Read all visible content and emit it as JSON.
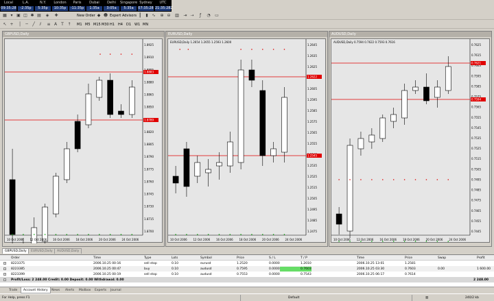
{
  "clocks": [
    {
      "city": "Local",
      "time": "09:35:28"
    },
    {
      "city": "L.A.",
      "time": "-2:35p"
    },
    {
      "city": "N.Y.",
      "time": "5:35p"
    },
    {
      "city": "London",
      "time": "10:35p"
    },
    {
      "city": "Paris",
      "time": "-11:35p"
    },
    {
      "city": "Dubai",
      "time": "1:35a"
    },
    {
      "city": "Delhi",
      "time": "3:05a"
    },
    {
      "city": "Singapore",
      "time": "5:35a"
    },
    {
      "city": "Sydney",
      "time": "07:35:28"
    },
    {
      "city": "UTC",
      "time": "21:35:28Z"
    }
  ],
  "toolbar": {
    "new_order": "New Order",
    "expert_advisors": "Expert Advisors",
    "timeframes": [
      "M1",
      "M5",
      "M15",
      "M30",
      "H1",
      "H4",
      "D1",
      "W1",
      "MN"
    ]
  },
  "charts": [
    {
      "title": "GBPUSD,Daily",
      "info": "",
      "price_labels": [
        "1.8925",
        "1.8910",
        "1.8895",
        "1.8880",
        "1.8865",
        "1.8850",
        "1.8835",
        "1.8820",
        "1.8805",
        "1.8790",
        "1.8775",
        "1.8760",
        "1.8745",
        "1.8730",
        "1.8715",
        "1.8700"
      ],
      "highlight_labels": [
        "1.8883",
        "1.8789"
      ],
      "date_labels": [
        "10 Oct 2006",
        "12 Oct 2006",
        "16 Oct 2006",
        "18 Oct 2006",
        "20 Oct 2006",
        "24 Oct 2006"
      ]
    },
    {
      "title": "EURUSD,Daily",
      "info": "EURUSD,Daily 1.2654 1.2655 1.2593 1.2600",
      "price_labels": [
        "1.2645",
        "1.2635",
        "1.2625",
        "1.2615",
        "1.2605",
        "1.2595",
        "1.2585",
        "1.2575",
        "1.2565",
        "1.2555",
        "1.2545",
        "1.2535",
        "1.2525",
        "1.2515",
        "1.2505",
        "1.2495",
        "1.2485",
        "1.2475"
      ],
      "highlight_labels": [
        "1.2622",
        "1.2545"
      ],
      "date_labels": [
        "10 Oct 2006",
        "12 Oct 2006",
        "16 Oct 2006",
        "18 Oct 2006",
        "20 Oct 2006",
        "24 Oct 2006"
      ]
    },
    {
      "title": "AUDUSD,Daily",
      "info": "AUDUSD,Daily 0.7594 0.7622 0.7593 0.7616",
      "price_labels": [
        "0.7625",
        "0.7615",
        "0.7605",
        "0.7595",
        "0.7585",
        "0.7575",
        "0.7565",
        "0.7555",
        "0.7545",
        "0.7535",
        "0.7525",
        "0.7515",
        "0.7505",
        "0.7495",
        "0.7485",
        "0.7475",
        "0.7465",
        "0.7455",
        "0.7445"
      ],
      "highlight_labels": [
        "0.7621",
        "0.7594"
      ],
      "date_labels": [
        "10 Oct 2006",
        "12 Oct 2006",
        "16 Oct 2006",
        "18 Oct 2006",
        "20 Oct 2006",
        "24 Oct 2006"
      ]
    }
  ],
  "symbol_tabs": [
    "GBPUSD,Daily",
    "EURUSD,Daily",
    "AUDUSD,Daily"
  ],
  "terminal": {
    "headers": {
      "order": "Order",
      "time": "Time",
      "type": "Type",
      "lots": "Lots",
      "symbol": "Symbol",
      "price": "Price",
      "sl": "S / L",
      "tp": "T / P",
      "time2": "Time",
      "price2": "Price",
      "swap": "Swap",
      "profit": "Profit"
    },
    "rows": [
      {
        "order": "8223375",
        "time": "2006.10.25 00:16",
        "type": "sell stop",
        "lots": "0.10",
        "symbol": "eurusd",
        "price": "1.2520",
        "sl": "0.0000",
        "tp": "1.2010",
        "time2": "2006.10.25 13:01",
        "price2": "1.2581",
        "swap": "",
        "profit": ""
      },
      {
        "order": "8223385",
        "time": "2006.10.25 00:47",
        "type": "buy",
        "lots": "0.10",
        "symbol": "audusd",
        "price": "0.7595",
        "sl": "0.0000",
        "tp": "0.7603",
        "time2": "2006.10.25 03:30",
        "price2": "0.7603",
        "swap": "0.00",
        "profit": "1 600.00"
      },
      {
        "order": "8223399",
        "time": "2006.10.25 00:19",
        "type": "sell stop",
        "lots": "0.10",
        "symbol": "audusd",
        "price": "0.7553",
        "sl": "0.0000",
        "tp": "0.7543",
        "time2": "2006.10.25 06:17",
        "price2": "0.7614",
        "swap": "",
        "profit": ""
      }
    ],
    "summary": "Profit/Loss: 2 248.00  Credit: 0.00  Deposit: 0.00  Withdrawal: 0.00",
    "summary_total": "2 248.00"
  },
  "terminal_tabs": [
    "Trade",
    "Account History",
    "News",
    "Alerts",
    "Mailbox",
    "Experts",
    "Journal"
  ],
  "status": {
    "help": "For Help, press F1",
    "profile": "Default",
    "traffic": "240/2 kb"
  }
}
